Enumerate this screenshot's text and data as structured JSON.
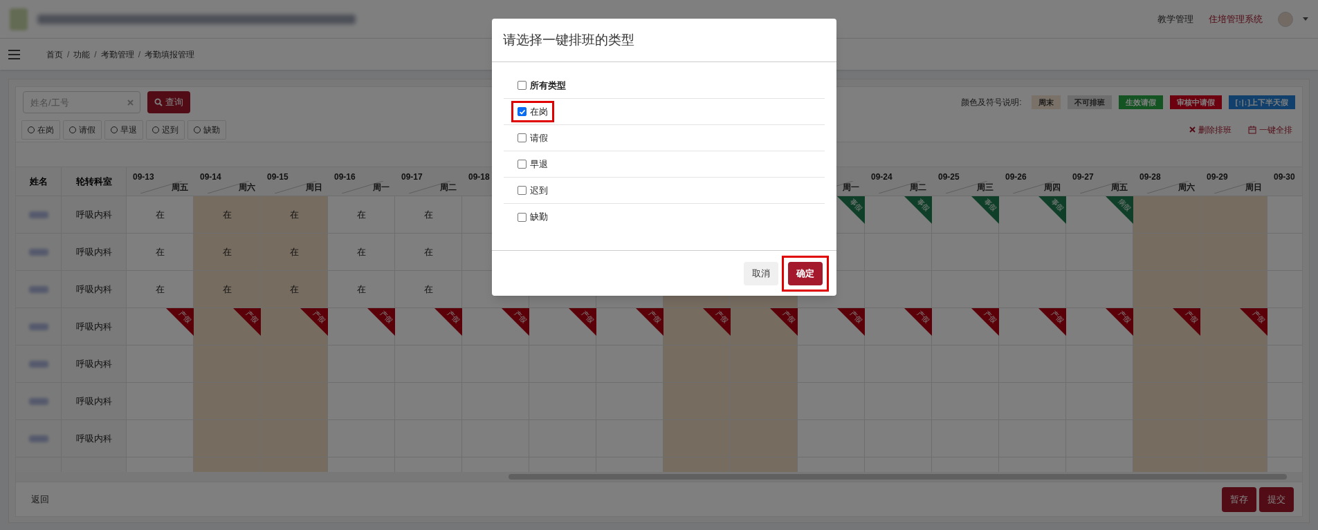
{
  "header": {
    "nav": [
      {
        "label": "教学管理",
        "selected": false
      },
      {
        "label": "住培管理系统",
        "selected": true
      }
    ]
  },
  "breadcrumb": {
    "separator": "/",
    "items": [
      "首页",
      "功能",
      "考勤管理",
      "考勤填报管理"
    ]
  },
  "search": {
    "placeholder": "姓名/工号",
    "button": "查询"
  },
  "legend": {
    "label": "颜色及符号说明:",
    "items": [
      {
        "label": "周末",
        "color": "#7a7268"
      },
      {
        "label": "不可排班",
        "color": "#6e6e6e"
      },
      {
        "label": "生效请假",
        "color": "#145423"
      },
      {
        "label": "审核中请假",
        "color": "#6d000e"
      },
      {
        "label": "[↑|↓]上下半天假",
        "color": "#10406b"
      }
    ]
  },
  "filters": [
    "在岗",
    "请假",
    "早退",
    "迟到",
    "缺勤"
  ],
  "actions": [
    {
      "kind": "delete",
      "label": "删除排班"
    },
    {
      "kind": "calendar",
      "label": "一键全排"
    }
  ],
  "table": {
    "name_header": "姓名",
    "dept_header": "轮转科室",
    "columns": [
      {
        "date": "09-13",
        "weekday": "周五",
        "weekend": false
      },
      {
        "date": "09-14",
        "weekday": "周六",
        "weekend": true
      },
      {
        "date": "09-15",
        "weekday": "周日",
        "weekend": true
      },
      {
        "date": "09-16",
        "weekday": "周一",
        "weekend": false
      },
      {
        "date": "09-17",
        "weekday": "周二",
        "weekend": false
      },
      {
        "date": "09-18",
        "weekend": false
      },
      {
        "weekend": false
      },
      {
        "weekend": false
      },
      {
        "weekend": true
      },
      {
        "weekend": true
      },
      {
        "weekday": "周一",
        "weekend": false
      },
      {
        "date": "09-24",
        "weekday": "周二",
        "weekend": false
      },
      {
        "date": "09-25",
        "weekday": "周三",
        "weekend": false
      },
      {
        "date": "09-26",
        "weekday": "周四",
        "weekend": false
      },
      {
        "date": "09-27",
        "weekday": "周五",
        "weekend": false
      },
      {
        "date": "09-28",
        "weekday": "周六",
        "weekend": true
      },
      {
        "date": "09-29",
        "weekday": "周日",
        "weekend": true
      },
      {
        "date": "09-30",
        "weekend": false
      }
    ],
    "rows": [
      {
        "dept": "呼吸内科",
        "cells": [
          {
            "kind": "text",
            "text": "在"
          },
          {
            "kind": "text",
            "text": "在"
          },
          {
            "kind": "text",
            "text": "在"
          },
          {
            "kind": "text",
            "text": "在"
          },
          {
            "kind": "text",
            "text": "在"
          },
          null,
          null,
          null,
          null,
          null,
          {
            "kind": "tag",
            "text": "事假",
            "color": "#0f3f28"
          },
          {
            "kind": "tag",
            "text": "事假",
            "color": "#0f3f28"
          },
          {
            "kind": "tag",
            "text": "事假",
            "color": "#0f3f28"
          },
          {
            "kind": "tag",
            "text": "事假",
            "color": "#0f3f28"
          },
          {
            "kind": "tag",
            "text": "病假",
            "color": "#0f3f28"
          },
          null,
          null,
          null
        ]
      },
      {
        "dept": "呼吸内科",
        "cells": [
          {
            "kind": "text",
            "text": "在"
          },
          {
            "kind": "text",
            "text": "在"
          },
          {
            "kind": "text",
            "text": "在"
          },
          {
            "kind": "text",
            "text": "在"
          },
          {
            "kind": "text",
            "text": "在"
          },
          null,
          null,
          null,
          null,
          null,
          null,
          null,
          null,
          null,
          null,
          null,
          null,
          null
        ]
      },
      {
        "dept": "呼吸内科",
        "cells": [
          {
            "kind": "text",
            "text": "在"
          },
          {
            "kind": "text",
            "text": "在"
          },
          {
            "kind": "text",
            "text": "在"
          },
          {
            "kind": "text",
            "text": "在"
          },
          {
            "kind": "text",
            "text": "在"
          },
          null,
          null,
          null,
          null,
          null,
          null,
          null,
          null,
          null,
          null,
          null,
          null,
          null
        ]
      },
      {
        "dept": "呼吸内科",
        "cells": [
          {
            "kind": "tag",
            "text": "产假",
            "color": "#5b0008"
          },
          {
            "kind": "tag",
            "text": "产假",
            "color": "#5b0008"
          },
          {
            "kind": "tag",
            "text": "产假",
            "color": "#5b0008"
          },
          {
            "kind": "tag",
            "text": "产假",
            "color": "#5b0008"
          },
          {
            "kind": "tag",
            "text": "产假",
            "color": "#5b0008"
          },
          {
            "kind": "tag",
            "text": "产假",
            "color": "#5b0008"
          },
          {
            "kind": "tag",
            "text": "产假",
            "color": "#5b0008"
          },
          {
            "kind": "tag",
            "text": "产假",
            "color": "#5b0008"
          },
          {
            "kind": "tag",
            "text": "产假",
            "color": "#5b0008"
          },
          {
            "kind": "tag",
            "text": "产假",
            "color": "#5b0008"
          },
          {
            "kind": "tag",
            "text": "产假",
            "color": "#5b0008"
          },
          {
            "kind": "tag",
            "text": "产假",
            "color": "#5b0008"
          },
          {
            "kind": "tag",
            "text": "产假",
            "color": "#5b0008"
          },
          {
            "kind": "tag",
            "text": "产假",
            "color": "#5b0008"
          },
          {
            "kind": "tag",
            "text": "产假",
            "color": "#5b0008"
          },
          {
            "kind": "tag",
            "text": "产假",
            "color": "#5b0008"
          },
          {
            "kind": "tag",
            "text": "产假",
            "color": "#5b0008"
          },
          null
        ]
      },
      {
        "dept": "呼吸内科",
        "cells": [
          null,
          null,
          null,
          null,
          null,
          null,
          null,
          null,
          null,
          null,
          null,
          null,
          null,
          null,
          null,
          null,
          null,
          null
        ]
      },
      {
        "dept": "呼吸内科",
        "cells": [
          null,
          null,
          null,
          null,
          null,
          null,
          null,
          null,
          null,
          null,
          null,
          null,
          null,
          null,
          null,
          null,
          null,
          null
        ]
      },
      {
        "dept": "呼吸内科",
        "cells": [
          null,
          null,
          null,
          null,
          null,
          null,
          null,
          null,
          null,
          null,
          null,
          null,
          null,
          null,
          null,
          null,
          null,
          null
        ]
      }
    ]
  },
  "footer": {
    "back": "返回",
    "buttons": [
      "暂存",
      "提交"
    ]
  },
  "modal": {
    "title": "请选择一键排班的类型",
    "options": [
      {
        "kind": "all",
        "label": "所有类型",
        "checked": false,
        "highlighted": false
      },
      {
        "kind": "option",
        "label": "在岗",
        "checked": true,
        "highlighted": true
      },
      {
        "kind": "option",
        "label": "请假",
        "checked": false,
        "highlighted": false
      },
      {
        "kind": "option",
        "label": "早退",
        "checked": false,
        "highlighted": false
      },
      {
        "kind": "option",
        "label": "迟到",
        "checked": false,
        "highlighted": false
      },
      {
        "kind": "option",
        "label": "缺勤",
        "checked": false,
        "highlighted": false
      }
    ],
    "buttons": [
      {
        "kind": "cancel",
        "label": "取消",
        "highlighted": false
      },
      {
        "kind": "confirm",
        "label": "确定",
        "highlighted": true
      }
    ]
  }
}
